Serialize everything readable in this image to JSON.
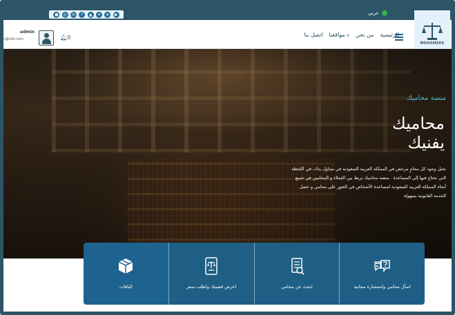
{
  "colors": {
    "brand": "#2c5566",
    "service_bar": "#1f5f86",
    "accent_text": "#48b9d6",
    "online_dot": "#2fb44a"
  },
  "topbar": {
    "language": "عربي",
    "social_icons": [
      "whatsapp-icon",
      "instagram-icon",
      "linkedin-icon",
      "facebook-icon",
      "snapchat-icon",
      "twitter-icon",
      "telegram-icon",
      "youtube-icon"
    ]
  },
  "header": {
    "logo_wordmark": "MOHAMEEK",
    "nav": [
      "الرئيسية",
      "من نحن",
      "مواقعنا",
      "اتصل بنا"
    ],
    "user_name": "admin",
    "user_email": "ph@info.com",
    "notifications_count": "0"
  },
  "hero": {
    "eyebrow": "منصة محاميك",
    "title_line1": "محاميك",
    "title_line2": "يفنيك",
    "description": "نخيل وجود كل محامٍ مرخص في المملكة العربية السعودية في متناول يدك، في اللحظة التي تحتاج فيها إلى المساعدة . منصة محاميك تربط بين العملاء و المحامين في جميع أنحاء المملكة العربية السعودية لمساعدة الأشخاص في العثور على محامي و حصل الخدمة القانونية بسهولة"
  },
  "services": [
    {
      "label": "اسأل محامي واستشارة مجانية",
      "icon": "chat-question-icon"
    },
    {
      "label": "ابحث عن محامي",
      "icon": "search-lawyer-icon"
    },
    {
      "label": "اعرض قضيتك واطلب سعر",
      "icon": "case-document-icon"
    },
    {
      "label": "الباقات",
      "icon": "package-box-icon"
    }
  ]
}
